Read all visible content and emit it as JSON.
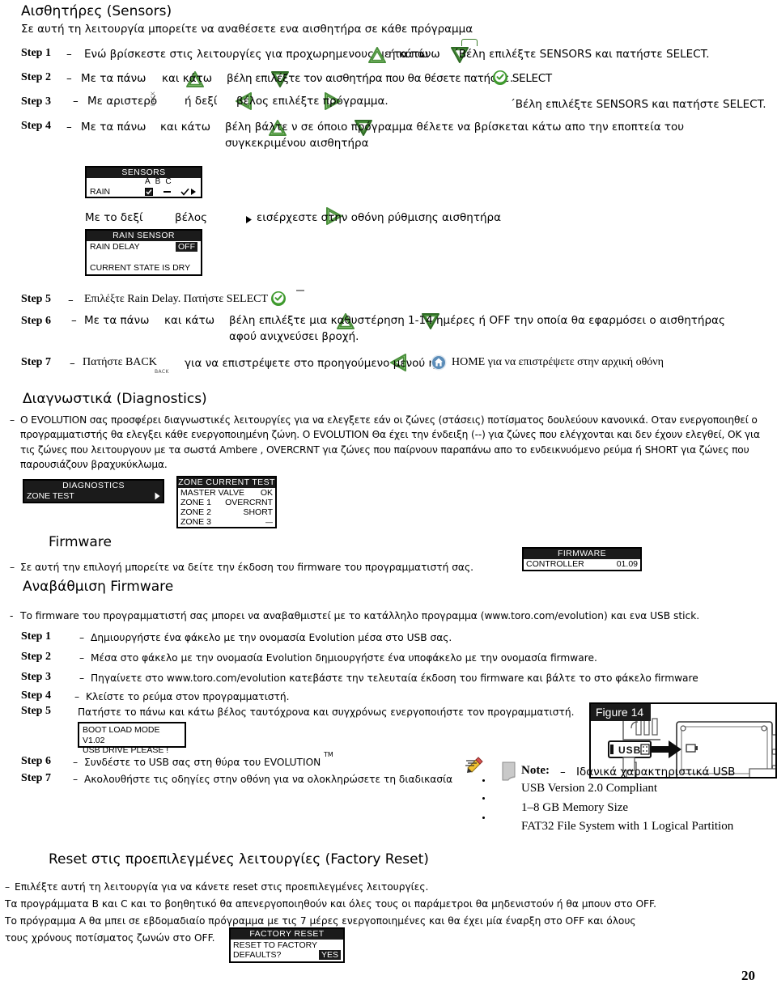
{
  "colors": {
    "arrow_green_dark": "#4a8f3c",
    "arrow_green_light": "#8fc97a",
    "select_green": "#3f9a2e",
    "home_blue": "#5b8cb8",
    "lcd_dark": "#1b1b1b"
  },
  "sensors_section": {
    "heading": "Αισθητήρες (Sensors)",
    "intro": "Σε αυτή τη λειτουργία μπορείτε να αναθέσετε ενα αισθητήρα σε κάθε πρόγραμμα",
    "steps": [
      {
        "label": "Step 1",
        "dash": "–",
        "text_a": "Ενώ βρίσκεστε στις λειτουργίες για προχωρημενους με τα πάνω",
        "text_b": "ή κάτω",
        "text_c": "´Βέλη επιλέξτε SENSORS και πατήστε SELECT."
      },
      {
        "label": "Step 2",
        "dash": "–",
        "text_a": "Με τα πάνω",
        "text_b": "και κάτω",
        "text_c": "βέλη επιλέξτε τον αισθητήρα που θα θέσετε πατήστε SELECT",
        "text_d": "."
      },
      {
        "label": "Step 3",
        "dash": "–",
        "text_a": "Με αριστερό",
        "text_b": "ή δεξί",
        "text_c": "βέλος επιλέξτε πρόγραμμα.",
        "text_d": "´Βέλη επιλέξτε SENSORS και πατήστε SELECT."
      },
      {
        "label": "Step 4",
        "dash": "–",
        "text_a": "Με τα πάνω",
        "text_b": "και κάτω",
        "text_c": "βέλη βάλτε ν σε όποιο πρόγραμμα θέλετε να βρίσκεται κάτω απο την εποπτεία του",
        "text_d": "συγκεκριμένου αισθητήρα"
      }
    ],
    "lcd_sensors": {
      "title": "SENSORS",
      "col_a": "A",
      "col_b": "B",
      "col_c": "C",
      "row_label": "RAIN",
      "val_a": "checkbox-checked",
      "val_b": "dash",
      "val_c": "check-arrow"
    },
    "right_arrow_line": {
      "text_a": "Με το δεξί",
      "text_b": "βέλος",
      "text_c": "εισέρχεστε στην οθόνη ρύθμισης αισθητήρα"
    },
    "lcd_rain_sensor": {
      "title": "RAIN SENSOR",
      "row1_label": "RAIN DELAY",
      "row1_value": "OFF",
      "row2": "CURRENT STATE IS DRY"
    },
    "steps2": [
      {
        "label": "Step 5",
        "dash": "–",
        "text_a": "Επιλέξτε  Rain Delay. Πατήστε SELECT"
      },
      {
        "label": "Step 6",
        "dash": "–",
        "text_a": "Με τα πάνω",
        "text_b": "και κάτω",
        "text_c": "βέλη επιλέξτε μια καθυστέρηση 1-14 ημέρες ή OFF την οποία θα εφαρμόσει ο αισθητήρας",
        "text_d": "αφού ανιχνεύσει βροχή."
      },
      {
        "label": "Step 7",
        "dash": "–",
        "text_a": "Πατήστε BACK",
        "text_b": "για να επιστρέψετε στο προηγούμενο μενού ή",
        "text_c": "HOME για να επιστρέψετε στην αρχική οθόνη"
      }
    ],
    "back_caption": "BACK"
  },
  "diagnostics_section": {
    "heading": "Διαγνωστικά (Diagnostics)",
    "dash": "–",
    "paragraph": "Ο EVOLUTION σας προσφέρει διαγνωστικές λειτουργίες για να ελεγξετε εάν οι ζώνες (στάσεις) ποτίσματος δουλεύουν κανονικά. Οταν ενεργοποιηθεί ο προγραμματιστής θα ελεγξει κάθε ενεργοποιημένη ζώνη. Ο EVOLUTION Θα έχει την ένδειξη (--) για ζώνες που ελέγχονται και δεν έχουν ελεγθεί, ΟΚ για τις ζώνες που λειτουργουν με τα σωστά Ambere , OVERCRNT για ζώνες που παίρνουν παραπάνω απο το ενδεικνυόμενο ρεύμα ή SHORT για ζώνες που παρουσιάζουν βραχυκύκλωμα.",
    "lcd_diagnostics": {
      "title": "DIAGNOSTICS",
      "row1": "ZONE TEST"
    },
    "lcd_zone_test": {
      "title": "ZONE CURRENT TEST",
      "rows": [
        {
          "label": "MASTER VALVE",
          "value": "OK"
        },
        {
          "label": "ZONE 1",
          "value": "OVERCRNT"
        },
        {
          "label": "ZONE 2",
          "value": "SHORT"
        },
        {
          "label": "ZONE 3",
          "value": "—"
        }
      ]
    }
  },
  "firmware_section": {
    "heading": "Firmware",
    "dash": "–",
    "line": "Σε αυτή την επιλογή μπορείτε να δείτε την έκδοση του firmware του προγραμματιστή σας.",
    "lcd_firmware": {
      "title": "FIRMWARE",
      "row_label": "CONTROLLER",
      "row_value": "01.09"
    }
  },
  "upgrade_section": {
    "heading": "Αναβάθμιση Firmware",
    "dash": "-",
    "intro": "Το firmware  του προγραμματιστή σας μπορει να αναβαθμιστεί με το κατάλληλο προγραμμα (www.toro.com/evolution) και ενα USB stick.",
    "steps": [
      {
        "label": "Step 1",
        "dash": "–",
        "text": "Δημιουργήστε ένα φάκελο με την ονομασία Evolution μέσα στο USB σας."
      },
      {
        "label": "Step 2",
        "dash": "–",
        "text": "Μέσα στο φάκελο με την ονομασία Evolution δημιουργήστε ένα υποφάκελο με την ονομασία firmware."
      },
      {
        "label": "Step 3",
        "dash": "–",
        "text": "Πηγαίνετε στο www.toro.com/evolution κατεβάστε την τελευταία έκδοση του firmware και βάλτε το στο φάκελο firmware"
      },
      {
        "label": "Step 4",
        "dash": "–",
        "text": "Κλείστε το ρεύμα στον προγραμματιστή."
      },
      {
        "label": "Step 5",
        "dash": "",
        "text": "Πατήστε το πάνω και κάτω βέλος ταυτόχρονα και συγχρόνως ενεργοποιήστε τον προγραμματιστή."
      }
    ],
    "lcd_bootload": {
      "line1": "BOOT LOAD MODE V1.02",
      "line2": "USB DRIVE PLEASE !"
    },
    "steps_tail": [
      {
        "label": "Step 6",
        "dash": "–",
        "text": "Συνδέστε το USB σας στη θύρα του EVOLUTION",
        "sup": "TM"
      },
      {
        "label": "Step 7",
        "dash": "–",
        "text": "Ακολουθήστε τις οδηγίες στην οθόνη για να ολοκληρώσετε τη διαδικασία"
      }
    ],
    "figure": {
      "tag": "Figure 14",
      "usb_label": "USB"
    },
    "note": {
      "label": "Note:",
      "dash": "–",
      "title": "Ιδανικά χαρακτηριστικά USB",
      "items": [
        "USB Version 2.0 Compliant",
        "1–8 GB Memory Size",
        "FAT32 File System with 1 Logical Partition"
      ]
    }
  },
  "factory_reset_section": {
    "heading": "Reset στις προεπιλεγμένες λειτουργίες (Factory Reset)",
    "dash": "–",
    "lines": [
      "Επιλέξτε αυτή τη λειτουργία για να κάνετε reset στις προεπιλεγμένες λειτουργίες.",
      "Τα προγράμματα Β και C και το βοηθητικό θα απενεργοποιηθούν και όλες τους οι παράμετροι θα μηδενιστούν ή θα μπουν στο OFF.",
      "Το πρόγραμμα Α θα μπει σε εβδομαδιαίο πρόγραμμα με τις 7 μέρες ενεργοποιημένες και θα έχει μία έναρξη στο OFF και όλους",
      "τους χρόνους ποτίσματος ζωνών στο OFF."
    ],
    "lcd_factory_reset": {
      "title": "FACTORY RESET",
      "line1": "RESET TO FACTORY",
      "line2_label": "DEFAULTS?",
      "line2_value": "YES"
    }
  },
  "page_number": "20"
}
